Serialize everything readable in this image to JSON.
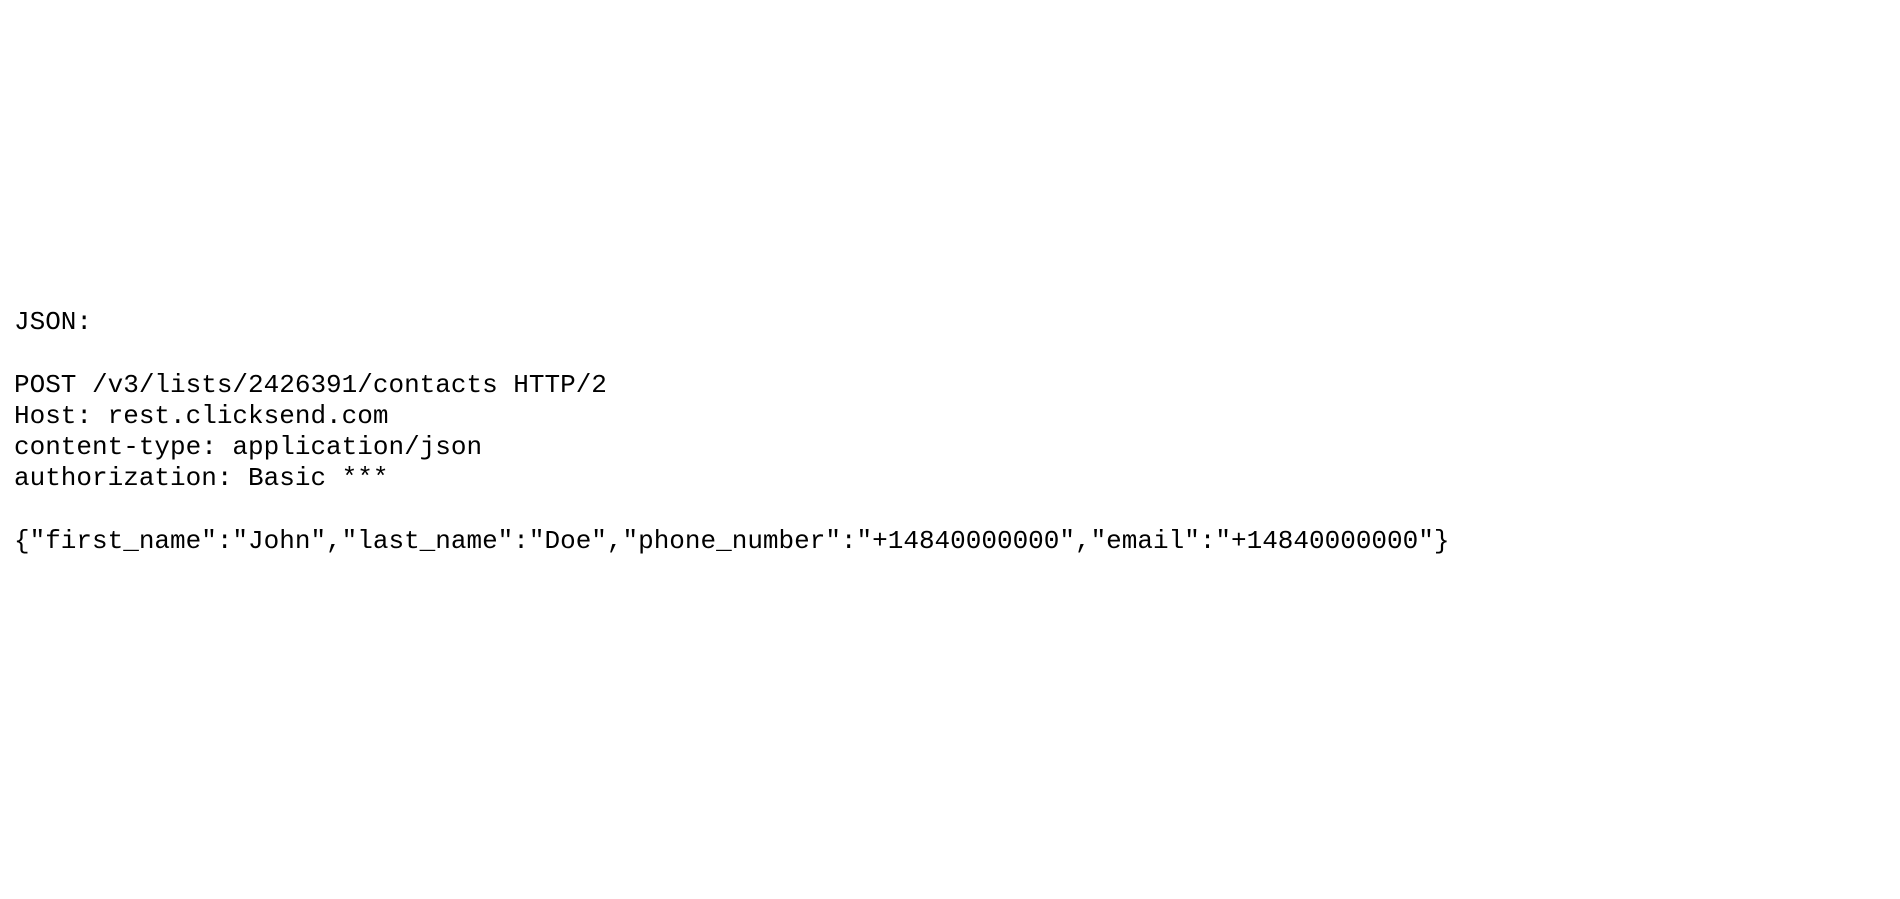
{
  "code": {
    "label": "JSON:",
    "blank1": "",
    "request_line": "POST /v3/lists/2426391/contacts HTTP/2",
    "host_header": "Host: rest.clicksend.com",
    "content_type_header": "content-type: application/json",
    "auth_header": "authorization: Basic ***",
    "blank2": "",
    "body": "{\"first_name\":\"John\",\"last_name\":\"Doe\",\"phone_number\":\"+14840000000\",\"email\":\"+14840000000\"}"
  }
}
